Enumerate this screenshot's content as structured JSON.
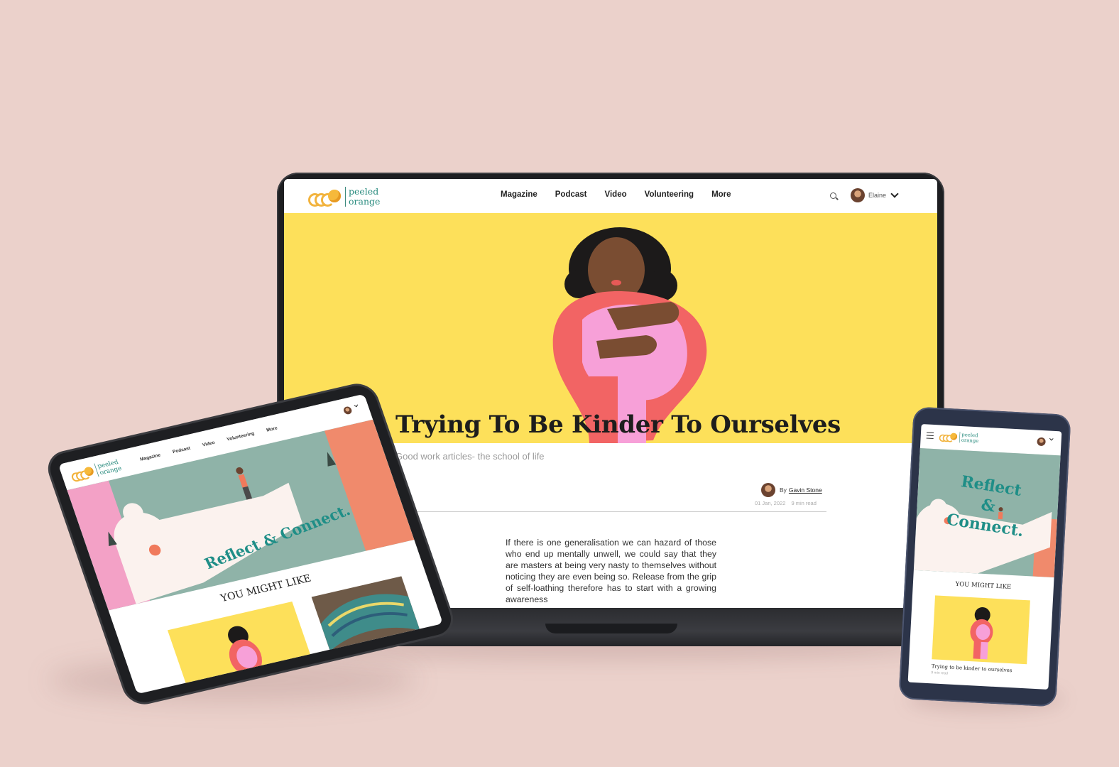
{
  "brand": {
    "line1": "peeled",
    "line2": "orange"
  },
  "nav": {
    "items": [
      "Magazine",
      "Podcast",
      "Video",
      "Volunteering",
      "More"
    ],
    "user_name": "Elaine"
  },
  "article": {
    "title": "Trying To Be Kinder To Ourselves",
    "subtitle": "Good work articles- the school of life",
    "by_label": "By",
    "author": "Gavin Stone",
    "date": "01 Jan, 2022",
    "read_time": "9 min read",
    "body": "If there is one generalisation we can hazard of those who end up mentally unwell, we could say that they are masters at being very nasty to themselves without noticing they are even being so. Release from the grip of self-loathing therefore has to start with a growing awareness"
  },
  "tablet": {
    "hero_text": "Reflect & Connect.",
    "section_heading": "YOU MIGHT LIKE"
  },
  "phone": {
    "hero_line1": "Reflect",
    "hero_line2": "&",
    "hero_line3": "Connect.",
    "section_heading": "YOU MIGHT LIKE",
    "card_title": "Trying to be kinder to ourselves",
    "card_meta": "9 min read"
  },
  "colors": {
    "background": "#ebd1cb",
    "hero_yellow": "#fde05a",
    "brand_teal": "#2a8c7f",
    "accent_orange": "#f6b93b",
    "sage": "#8fb3a8"
  }
}
